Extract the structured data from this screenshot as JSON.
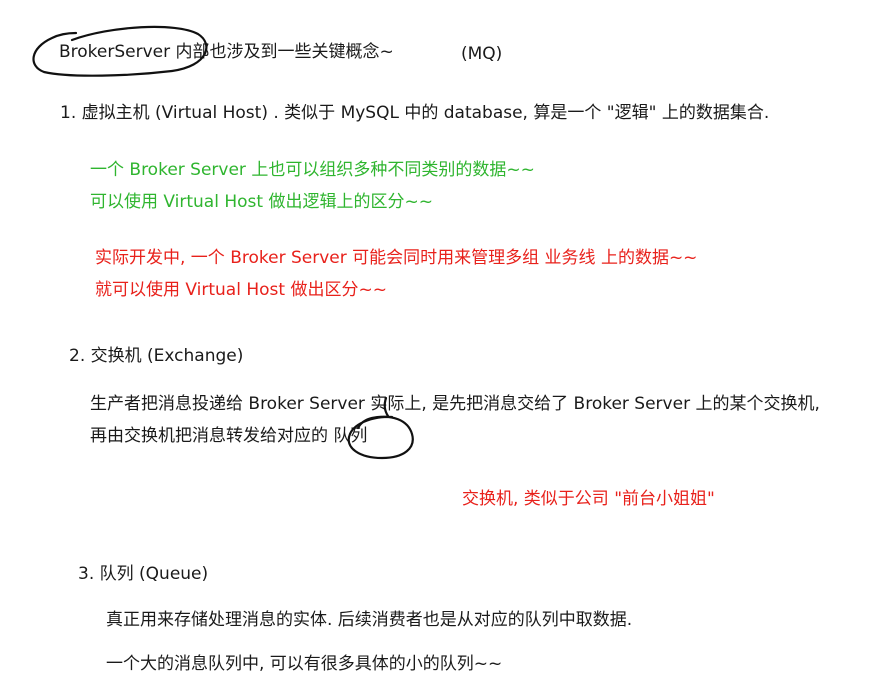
{
  "header": {
    "title": "BrokerServer 内部也涉及到一些关键概念~",
    "tag": "(MQ)"
  },
  "sections": [
    {
      "heading": "1. 虚拟主机 (Virtual Host) . 类似于 MySQL 中的 database, 算是一个 \"逻辑\" 上的数据集合.",
      "green_notes": [
        "一个 Broker Server 上也可以组织多种不同类别的数据~~",
        "可以使用 Virtual Host 做出逻辑上的区分~~"
      ],
      "red_notes": [
        "实际开发中, 一个 Broker Server 可能会同时用来管理多组 业务线 上的数据~~",
        "就可以使用 Virtual Host 做出区分~~"
      ]
    },
    {
      "heading": "2. 交换机 (Exchange)",
      "body": [
        "生产者把消息投递给 Broker Server 实际上, 是先把消息交给了 Broker Server 上的某个交换机,",
        "再由交换机把消息转发给对应的 队列"
      ],
      "red_notes": [
        "交换机, 类似于公司 \"前台小姐姐\""
      ]
    },
    {
      "heading": "3. 队列 (Queue)",
      "body": [
        "真正用来存储处理消息的实体. 后续消费者也是从对应的队列中取数据.",
        "一个大的消息队列中, 可以有很多具体的小的队列~~"
      ]
    }
  ],
  "colors": {
    "text": "#1a1a1a",
    "green": "#2fb52f",
    "red": "#e8211b",
    "ink": "#111111"
  }
}
